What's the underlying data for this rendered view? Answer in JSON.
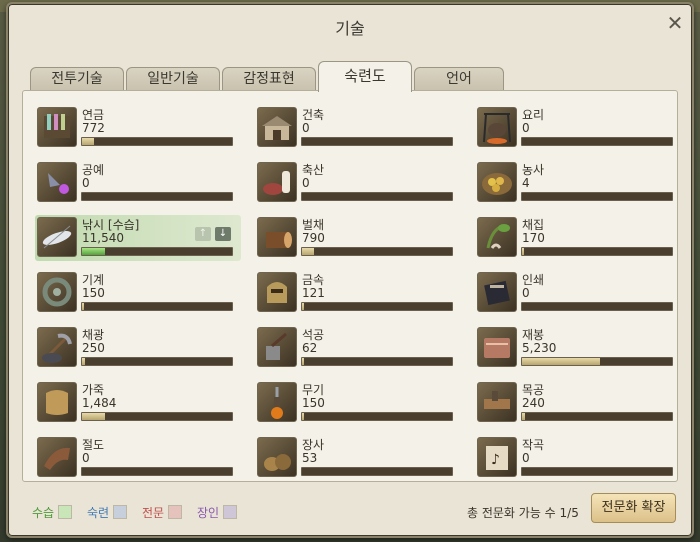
{
  "window": {
    "title": "기술",
    "close_glyph": "✕"
  },
  "tabs": [
    {
      "label": "전투기술",
      "active": false
    },
    {
      "label": "일반기술",
      "active": false
    },
    {
      "label": "감정표현",
      "active": false
    },
    {
      "label": "숙련도",
      "active": true
    },
    {
      "label": "언어",
      "active": false
    }
  ],
  "skills": [
    {
      "name": "연금",
      "value": "772",
      "progress": 0.08,
      "icon": "alchemy-icon"
    },
    {
      "name": "건축",
      "value": "0",
      "progress": 0.0,
      "icon": "construction-icon"
    },
    {
      "name": "요리",
      "value": "0",
      "progress": 0.0,
      "icon": "cooking-icon"
    },
    {
      "name": "공예",
      "value": "0",
      "progress": 0.0,
      "icon": "handicraft-icon"
    },
    {
      "name": "축산",
      "value": "0",
      "progress": 0.0,
      "icon": "husbandry-icon"
    },
    {
      "name": "농사",
      "value": "4",
      "progress": 0.0,
      "icon": "farming-icon"
    },
    {
      "name": "낚시 [수습]",
      "value": "11,540",
      "progress": 0.15,
      "icon": "fishing-icon",
      "highlight": true
    },
    {
      "name": "벌채",
      "value": "790",
      "progress": 0.08,
      "icon": "logging-icon"
    },
    {
      "name": "채집",
      "value": "170",
      "progress": 0.01,
      "icon": "gathering-icon"
    },
    {
      "name": "기계",
      "value": "150",
      "progress": 0.01,
      "icon": "machining-icon"
    },
    {
      "name": "금속",
      "value": "121",
      "progress": 0.01,
      "icon": "metalwork-icon"
    },
    {
      "name": "인쇄",
      "value": "0",
      "progress": 0.0,
      "icon": "printing-icon"
    },
    {
      "name": "채광",
      "value": "250",
      "progress": 0.02,
      "icon": "mining-icon"
    },
    {
      "name": "석공",
      "value": "62",
      "progress": 0.01,
      "icon": "masonry-icon"
    },
    {
      "name": "재봉",
      "value": "5,230",
      "progress": 0.52,
      "icon": "tailoring-icon"
    },
    {
      "name": "가죽",
      "value": "1,484",
      "progress": 0.15,
      "icon": "leatherwork-icon"
    },
    {
      "name": "무기",
      "value": "150",
      "progress": 0.01,
      "icon": "weaponry-icon"
    },
    {
      "name": "목공",
      "value": "240",
      "progress": 0.02,
      "icon": "carpentry-icon"
    },
    {
      "name": "절도",
      "value": "0",
      "progress": 0.0,
      "icon": "larceny-icon"
    },
    {
      "name": "장사",
      "value": "53",
      "progress": 0.0,
      "icon": "commerce-icon"
    },
    {
      "name": "작곡",
      "value": "0",
      "progress": 0.0,
      "icon": "composition-icon"
    }
  ],
  "fishing_controls": {
    "up": "↑",
    "down": "↓"
  },
  "legend": [
    {
      "label": "수습",
      "color": "#4f9a3b",
      "swatch": "#c9e6b8"
    },
    {
      "label": "숙련",
      "color": "#3f79b5",
      "swatch": "#c6cfdb"
    },
    {
      "label": "전문",
      "color": "#c0504d",
      "swatch": "#e6c2bd"
    },
    {
      "label": "장인",
      "color": "#8a58b0",
      "swatch": "#cfc6d8"
    }
  ],
  "footer": {
    "count_text": "총 전문화 가능 수 1/5",
    "expand_button": "전문화 확장"
  }
}
